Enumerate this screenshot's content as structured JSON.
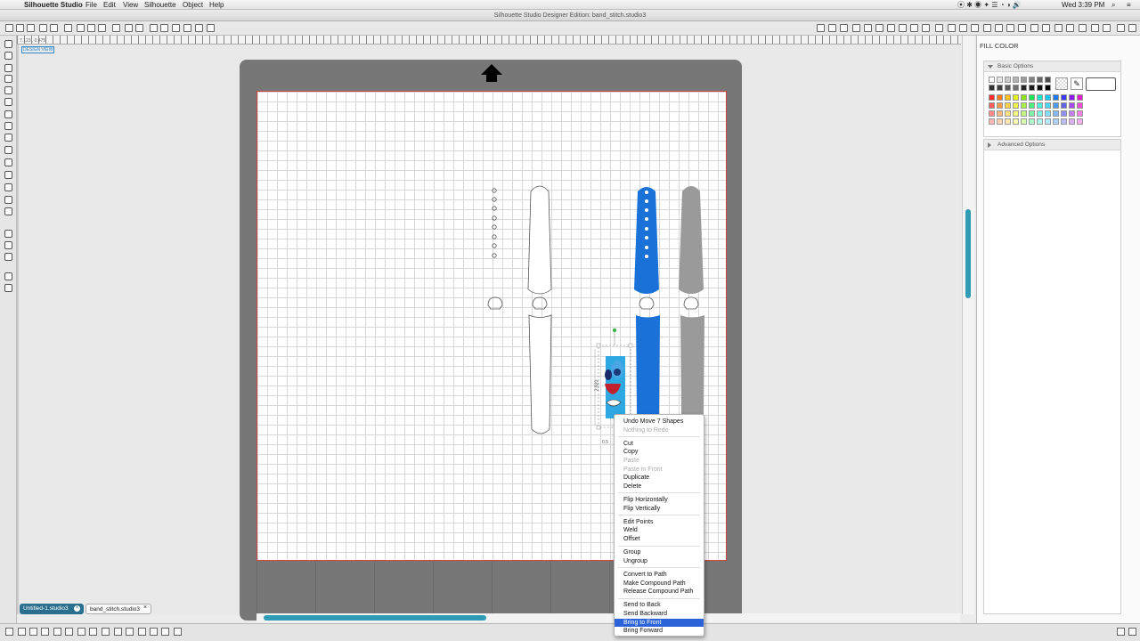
{
  "menubar": {
    "apple": "",
    "app": "Silhouette Studio",
    "items": [
      "File",
      "Edit",
      "View",
      "Silhouette",
      "Object",
      "Help"
    ],
    "clock": "Wed 3:39 PM"
  },
  "window": {
    "title": "Silhouette Studio Designer Edition: band_stitch.studio3"
  },
  "ruler": {
    "coords": "7.123 , 0.475",
    "view_label": "DESIGN VIEW"
  },
  "selection": {
    "height": "2.920",
    "width": "0.5"
  },
  "tabs": [
    {
      "label": "Untitled-1.studio3"
    },
    {
      "label": "band_stitch.studio3"
    }
  ],
  "panel": {
    "title": "FILL COLOR",
    "basic": "Basic Options",
    "advanced": "Advanced Options",
    "swatch_rows": [
      [
        "#ffffff",
        "#e6e6e6",
        "#cccccc",
        "#b3b3b3",
        "#999999",
        "#808080",
        "#666666",
        "#4d4d4d"
      ],
      [
        "#333333",
        "#404040",
        "#595959",
        "#737373",
        "#262626",
        "#1a1a1a",
        "#0d0d0d",
        "#000000"
      ],
      [
        "#ff2a2a",
        "#ff7a1a",
        "#ffc31a",
        "#e7f21a",
        "#8ce61a",
        "#1ae65a",
        "#1ae6c8",
        "#1ac8f2",
        "#1a7af2",
        "#3a3af2",
        "#8c1af2",
        "#e61ac8"
      ],
      [
        "#ff5c5c",
        "#ff9a4d",
        "#ffd24d",
        "#eef24d",
        "#a6ef4d",
        "#4def82",
        "#4defd6",
        "#4dd6f5",
        "#4d9af5",
        "#6464f5",
        "#a84df5",
        "#ef4dd6"
      ],
      [
        "#ff8a8a",
        "#ffb880",
        "#ffdd80",
        "#f4f780",
        "#c0f580",
        "#80f5a8",
        "#80f5e2",
        "#80e2f8",
        "#80b8f8",
        "#9090f8",
        "#c480f8",
        "#f580e2"
      ],
      [
        "#ffb8b8",
        "#ffd4b0",
        "#ffe9b0",
        "#f8fab0",
        "#dafab0",
        "#b0facc",
        "#b0faee",
        "#b0eefb",
        "#b0d4fb",
        "#bcbcfb",
        "#dcb0fb",
        "#fab0ee"
      ]
    ]
  },
  "context_menu": [
    {
      "label": "Undo Move 7 Shapes",
      "enabled": true
    },
    {
      "label": "Nothing to Redo",
      "enabled": false
    },
    {
      "label": "Cut",
      "enabled": true
    },
    {
      "label": "Copy",
      "enabled": true
    },
    {
      "label": "Paste",
      "enabled": false
    },
    {
      "label": "Paste in Front",
      "enabled": false
    },
    {
      "label": "Duplicate",
      "enabled": true
    },
    {
      "label": "Delete",
      "enabled": true
    },
    {
      "label": "Flip Horizontally",
      "enabled": true
    },
    {
      "label": "Flip Vertically",
      "enabled": true
    },
    {
      "label": "Edit Points",
      "enabled": true
    },
    {
      "label": "Weld",
      "enabled": true
    },
    {
      "label": "Offset",
      "enabled": true
    },
    {
      "label": "Group",
      "enabled": true
    },
    {
      "label": "Ungroup",
      "enabled": true
    },
    {
      "label": "Convert to Path",
      "enabled": true
    },
    {
      "label": "Make Compound Path",
      "enabled": true
    },
    {
      "label": "Release Compound Path",
      "enabled": true
    },
    {
      "label": "Send to Back",
      "enabled": true
    },
    {
      "label": "Send Backward",
      "enabled": true
    },
    {
      "label": "Bring to Front",
      "enabled": true,
      "highlighted": true
    },
    {
      "label": "Bring Forward",
      "enabled": true
    }
  ],
  "colors": {
    "accent": "#1a72d9",
    "band_gray": "#9a9a9a",
    "highlight": "#2d63d9"
  }
}
